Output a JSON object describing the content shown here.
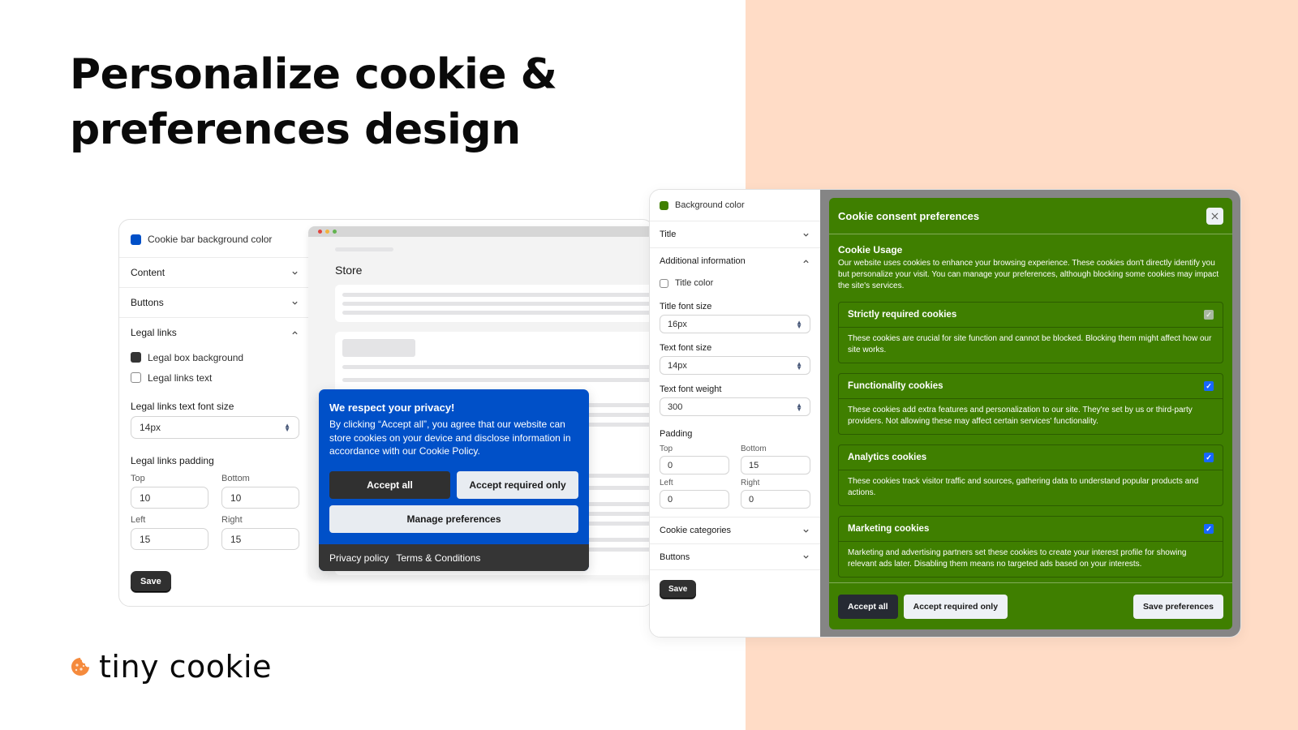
{
  "headline": "Personalize cookie & preferences design",
  "logo": {
    "text": "tiny cookie",
    "icon": "cookie-icon",
    "color": "#f58a3c"
  },
  "colors": {
    "peach_bg": "#ffdcc6",
    "banner_blue": "#0050c8",
    "modal_green": "#3f7f00",
    "dark": "#303030"
  },
  "left_panel": {
    "color_setting": {
      "label": "Cookie bar background color",
      "swatch": "#0050c8"
    },
    "sections": [
      {
        "label": "Content",
        "state": "collapsed"
      },
      {
        "label": "Buttons",
        "state": "collapsed"
      },
      {
        "label": "Legal links",
        "state": "expanded"
      }
    ],
    "legal_links": {
      "color_items": [
        {
          "label": "Legal box background",
          "swatch": "#353535"
        },
        {
          "label": "Legal links text",
          "swatch": ""
        }
      ],
      "font_size_label": "Legal links text font size",
      "font_size_value": "14px",
      "padding_label": "Legal links padding",
      "padding": {
        "top_label": "Top",
        "top": "10",
        "bottom_label": "Bottom",
        "bottom": "10",
        "left_label": "Left",
        "left": "15",
        "right_label": "Right",
        "right": "15"
      }
    },
    "save_label": "Save"
  },
  "store_preview": {
    "title": "Store",
    "banner": {
      "title": "We respect your privacy!",
      "text": "By clicking “Accept all”, you agree that our website can store cookies on your device and disclose information in accordance with our Cookie Policy.",
      "accept_all": "Accept all",
      "accept_required": "Accept required only",
      "manage": "Manage preferences",
      "links": [
        "Privacy policy",
        "Terms & Conditions"
      ]
    }
  },
  "right_panel": {
    "color_setting": {
      "label": "Background color",
      "swatch": "#3f7f00"
    },
    "sections_top": [
      {
        "label": "Title",
        "state": "collapsed"
      },
      {
        "label": "Additional information",
        "state": "expanded"
      }
    ],
    "additional": {
      "title_color_label": "Title color",
      "title_font_size_label": "Title font size",
      "title_font_size": "16px",
      "text_font_size_label": "Text font size",
      "text_font_size": "14px",
      "text_font_weight_label": "Text font weight",
      "text_font_weight": "300",
      "padding_label": "Padding",
      "padding": {
        "top_label": "Top",
        "top": "0",
        "bottom_label": "Bottom",
        "bottom": "15",
        "left_label": "Left",
        "left": "0",
        "right_label": "Right",
        "right": "0"
      }
    },
    "sections_bottom": [
      {
        "label": "Cookie categories",
        "state": "collapsed"
      },
      {
        "label": "Buttons",
        "state": "collapsed"
      }
    ],
    "save_label": "Save"
  },
  "modal": {
    "title": "Cookie consent preferences",
    "close_icon": "close-icon",
    "usage_title": "Cookie Usage",
    "usage_text": "Our website uses cookies to enhance your browsing experience. These cookies don't directly identify you but personalize your visit. You can manage your preferences, although blocking some cookies may impact the site's services.",
    "categories": [
      {
        "title": "Strictly required cookies",
        "checked": true,
        "disabled": true,
        "text": "These cookies are crucial for site function and cannot be blocked. Blocking them might affect how our site works."
      },
      {
        "title": "Functionality cookies",
        "checked": true,
        "disabled": false,
        "text": "These cookies add extra features and personalization to our site. They're set by us or third-party providers. Not allowing these may affect certain services' functionality."
      },
      {
        "title": "Analytics cookies",
        "checked": true,
        "disabled": false,
        "text": "These cookies track visitor traffic and sources, gathering data to understand popular products and actions."
      },
      {
        "title": "Marketing cookies",
        "checked": true,
        "disabled": false,
        "text": "Marketing and advertising partners set these cookies to create your interest profile for showing relevant ads later. Disabling them means no targeted ads based on your interests."
      }
    ],
    "accept_all": "Accept all",
    "accept_required": "Accept required only",
    "save_preferences": "Save preferences"
  }
}
